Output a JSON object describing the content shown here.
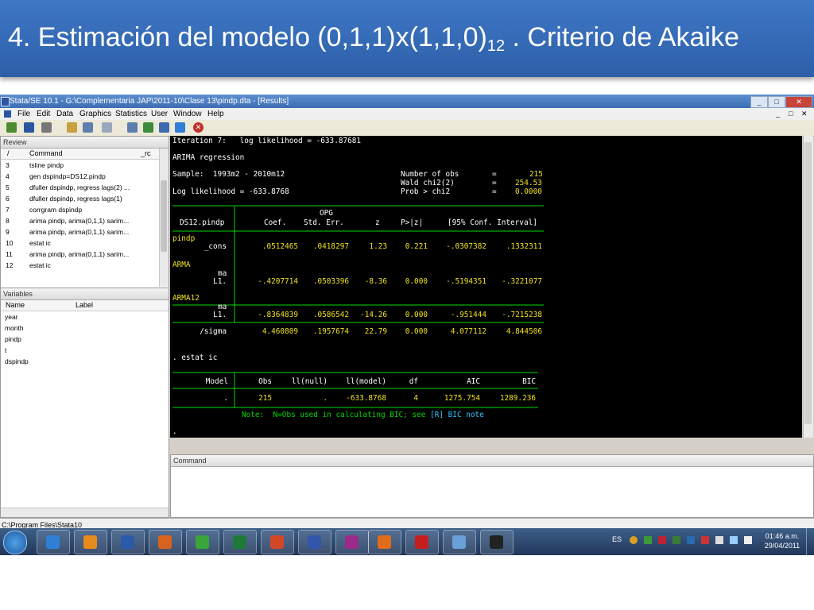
{
  "slide": {
    "title_main": "4. Estimación del modelo (0,1,1)x(1,1,0)",
    "title_sub": "12",
    "title_tail": " . Criterio de Akaike"
  },
  "window": {
    "title": "Stata/SE 10.1 - G:\\Complementaria JAP\\2011-10\\Clase 13\\pindp.dta - [Results]",
    "controls": [
      "_",
      "□",
      "✕"
    ]
  },
  "menu": [
    "File",
    "Edit",
    "Data",
    "Graphics",
    "Statistics",
    "User",
    "Window",
    "Help"
  ],
  "toolbar_icons": [
    "open-icon",
    "save-icon",
    "print-icon",
    "log-icon",
    "viewer-icon",
    "graph-icon",
    "do-editor-icon",
    "data-editor-icon",
    "data-browser-icon",
    "clear-more-icon",
    "break-icon"
  ],
  "review": {
    "header": "Review",
    "columns": [
      "/",
      "Command",
      "_rc"
    ],
    "items": [
      {
        "n": "3",
        "cmd": "tsline pindp"
      },
      {
        "n": "4",
        "cmd": "gen dspindp=DS12.pindp"
      },
      {
        "n": "5",
        "cmd": "dfuller dspindp, regress lags(2) ..."
      },
      {
        "n": "6",
        "cmd": "dfuller dspindp, regress lags(1)"
      },
      {
        "n": "7",
        "cmd": "corrgram dspindp"
      },
      {
        "n": "8",
        "cmd": "arima pindp, arima(0,1,1) sarim..."
      },
      {
        "n": "9",
        "cmd": "arima pindp, arima(0,1,1) sarim..."
      },
      {
        "n": "10",
        "cmd": "estat ic"
      },
      {
        "n": "11",
        "cmd": "arima pindp, arima(0,1,1) sarim..."
      },
      {
        "n": "12",
        "cmd": "estat ic"
      }
    ]
  },
  "variables": {
    "header": "Variables",
    "columns": [
      "Name",
      "Label"
    ],
    "items": [
      "year",
      "month",
      "pindp",
      "t",
      "dspindp"
    ]
  },
  "results": {
    "iteration_label": "Iteration 7:   log likelihood = -633.87681",
    "model_name": "ARIMA regression",
    "sample_label": "Sample:  1993m2 - 2010m12",
    "nobs_label": "Number of obs",
    "nobs": "215",
    "wald_label": "Wald chi2(2)",
    "wald": "254.53",
    "prob_label": "Prob > chi2",
    "prob": "0.0000",
    "loglik_label": "Log likelihood = -633.8768",
    "opg": "OPG",
    "depvar": "DS12.pindp",
    "col_coef": "Coef.",
    "col_se": "Std. Err.",
    "col_z": "z",
    "col_p": "P>|z|",
    "col_ci": "[95% Conf. Interval]",
    "eq_pindp": "pindp",
    "eq_arma": "ARMA",
    "eq_arma12": "ARMA12",
    "ma_label": "ma",
    "rows": [
      {
        "name": "_cons",
        "coef": ".0512465",
        "se": ".0418297",
        "z": "1.23",
        "p": "0.221",
        "lo": "-.0307382",
        "hi": ".1332311"
      },
      {
        "name": "L1.",
        "coef": "-.4207714",
        "se": ".0503396",
        "z": "-8.36",
        "p": "0.000",
        "lo": "-.5194351",
        "hi": "-.3221077"
      },
      {
        "name": "L1.",
        "coef": "-.8364839",
        "se": ".0586542",
        "z": "-14.26",
        "p": "0.000",
        "lo": "-.951444",
        "hi": "-.7215238"
      },
      {
        "name": "/sigma",
        "coef": "4.460809",
        "se": ".1957674",
        "z": "22.79",
        "p": "0.000",
        "lo": "4.077112",
        "hi": "4.844506"
      }
    ],
    "estat_cmd": ". estat ic",
    "ic_headers": [
      "Model",
      "Obs",
      "ll(null)",
      "ll(model)",
      "df",
      "AIC",
      "BIC"
    ],
    "ic_row": [
      ".",
      "215",
      ".",
      "-633.8768",
      "4",
      "1275.754",
      "1289.236"
    ],
    "note_prefix": "Note:  N=Obs used in calculating BIC; see",
    "note_link": "[R] BIC note",
    "prompt": "."
  },
  "command": {
    "header": "Command",
    "value": ""
  },
  "status": {
    "path": "C:\\Program Files\\Stata10"
  },
  "taskbar": {
    "apps": [
      {
        "name": "explorer",
        "color": "#2f7fd6"
      },
      {
        "name": "media",
        "color": "#e78b1c"
      },
      {
        "name": "word",
        "color": "#2a5aa8"
      },
      {
        "name": "firefox",
        "color": "#d9631e"
      },
      {
        "name": "chrome",
        "color": "#3aa53a"
      },
      {
        "name": "excel",
        "color": "#1f7a3a"
      },
      {
        "name": "powerpoint",
        "color": "#d24726"
      },
      {
        "name": "stata",
        "color": "#3355aa"
      },
      {
        "name": "hypercam",
        "color": "#9b2a8a"
      },
      {
        "name": "matlab",
        "color": "#e06c1c"
      },
      {
        "name": "acrobat",
        "color": "#c41e1e"
      },
      {
        "name": "paint",
        "color": "#6aa0d8"
      },
      {
        "name": "media-player",
        "color": "#222222"
      }
    ],
    "lang": "ES",
    "time": "01:46 a.m.",
    "date": "29/04/2011"
  }
}
